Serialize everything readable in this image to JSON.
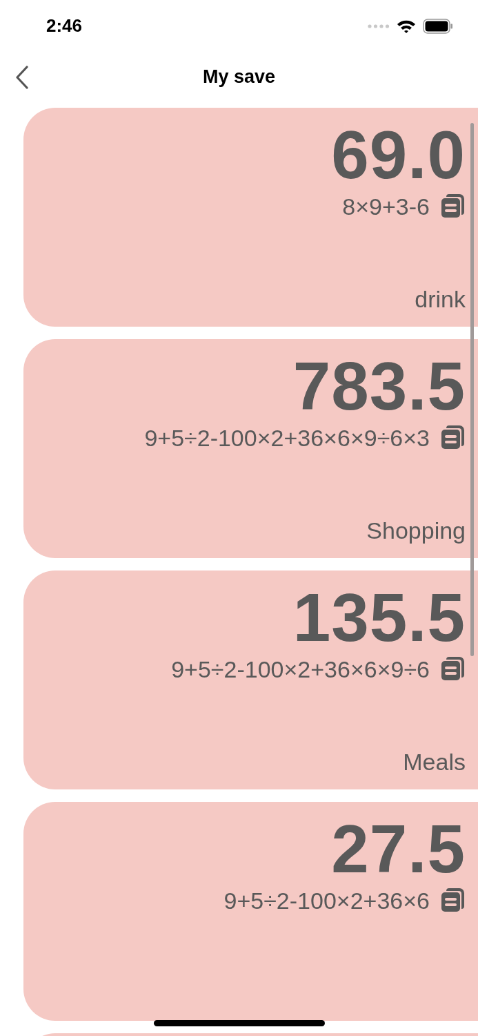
{
  "status_bar": {
    "time": "2:46"
  },
  "nav": {
    "title": "My save"
  },
  "entries": [
    {
      "result": "69.0",
      "expression": "8×9+3-6",
      "label": "drink"
    },
    {
      "result": "783.5",
      "expression": "9+5÷2-100×2+36×6×9÷6×3",
      "label": "Shopping"
    },
    {
      "result": "135.5",
      "expression": "9+5÷2-100×2+36×6×9÷6",
      "label": "Meals"
    },
    {
      "result": "27.5",
      "expression": "9+5÷2-100×2+36×6"
    }
  ]
}
